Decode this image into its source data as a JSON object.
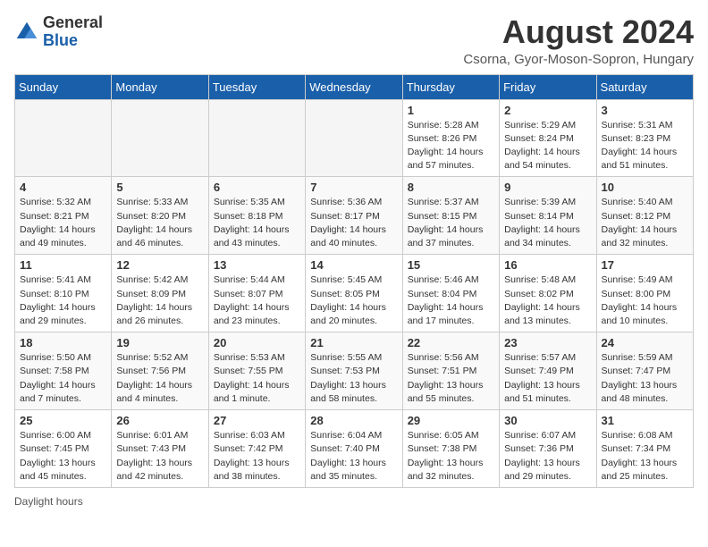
{
  "header": {
    "logo_general": "General",
    "logo_blue": "Blue",
    "month_year": "August 2024",
    "location": "Csorna, Gyor-Moson-Sopron, Hungary"
  },
  "weekdays": [
    "Sunday",
    "Monday",
    "Tuesday",
    "Wednesday",
    "Thursday",
    "Friday",
    "Saturday"
  ],
  "weeks": [
    [
      {
        "day": "",
        "info": ""
      },
      {
        "day": "",
        "info": ""
      },
      {
        "day": "",
        "info": ""
      },
      {
        "day": "",
        "info": ""
      },
      {
        "day": "1",
        "info": "Sunrise: 5:28 AM\nSunset: 8:26 PM\nDaylight: 14 hours\nand 57 minutes."
      },
      {
        "day": "2",
        "info": "Sunrise: 5:29 AM\nSunset: 8:24 PM\nDaylight: 14 hours\nand 54 minutes."
      },
      {
        "day": "3",
        "info": "Sunrise: 5:31 AM\nSunset: 8:23 PM\nDaylight: 14 hours\nand 51 minutes."
      }
    ],
    [
      {
        "day": "4",
        "info": "Sunrise: 5:32 AM\nSunset: 8:21 PM\nDaylight: 14 hours\nand 49 minutes."
      },
      {
        "day": "5",
        "info": "Sunrise: 5:33 AM\nSunset: 8:20 PM\nDaylight: 14 hours\nand 46 minutes."
      },
      {
        "day": "6",
        "info": "Sunrise: 5:35 AM\nSunset: 8:18 PM\nDaylight: 14 hours\nand 43 minutes."
      },
      {
        "day": "7",
        "info": "Sunrise: 5:36 AM\nSunset: 8:17 PM\nDaylight: 14 hours\nand 40 minutes."
      },
      {
        "day": "8",
        "info": "Sunrise: 5:37 AM\nSunset: 8:15 PM\nDaylight: 14 hours\nand 37 minutes."
      },
      {
        "day": "9",
        "info": "Sunrise: 5:39 AM\nSunset: 8:14 PM\nDaylight: 14 hours\nand 34 minutes."
      },
      {
        "day": "10",
        "info": "Sunrise: 5:40 AM\nSunset: 8:12 PM\nDaylight: 14 hours\nand 32 minutes."
      }
    ],
    [
      {
        "day": "11",
        "info": "Sunrise: 5:41 AM\nSunset: 8:10 PM\nDaylight: 14 hours\nand 29 minutes."
      },
      {
        "day": "12",
        "info": "Sunrise: 5:42 AM\nSunset: 8:09 PM\nDaylight: 14 hours\nand 26 minutes."
      },
      {
        "day": "13",
        "info": "Sunrise: 5:44 AM\nSunset: 8:07 PM\nDaylight: 14 hours\nand 23 minutes."
      },
      {
        "day": "14",
        "info": "Sunrise: 5:45 AM\nSunset: 8:05 PM\nDaylight: 14 hours\nand 20 minutes."
      },
      {
        "day": "15",
        "info": "Sunrise: 5:46 AM\nSunset: 8:04 PM\nDaylight: 14 hours\nand 17 minutes."
      },
      {
        "day": "16",
        "info": "Sunrise: 5:48 AM\nSunset: 8:02 PM\nDaylight: 14 hours\nand 13 minutes."
      },
      {
        "day": "17",
        "info": "Sunrise: 5:49 AM\nSunset: 8:00 PM\nDaylight: 14 hours\nand 10 minutes."
      }
    ],
    [
      {
        "day": "18",
        "info": "Sunrise: 5:50 AM\nSunset: 7:58 PM\nDaylight: 14 hours\nand 7 minutes."
      },
      {
        "day": "19",
        "info": "Sunrise: 5:52 AM\nSunset: 7:56 PM\nDaylight: 14 hours\nand 4 minutes."
      },
      {
        "day": "20",
        "info": "Sunrise: 5:53 AM\nSunset: 7:55 PM\nDaylight: 14 hours\nand 1 minute."
      },
      {
        "day": "21",
        "info": "Sunrise: 5:55 AM\nSunset: 7:53 PM\nDaylight: 13 hours\nand 58 minutes."
      },
      {
        "day": "22",
        "info": "Sunrise: 5:56 AM\nSunset: 7:51 PM\nDaylight: 13 hours\nand 55 minutes."
      },
      {
        "day": "23",
        "info": "Sunrise: 5:57 AM\nSunset: 7:49 PM\nDaylight: 13 hours\nand 51 minutes."
      },
      {
        "day": "24",
        "info": "Sunrise: 5:59 AM\nSunset: 7:47 PM\nDaylight: 13 hours\nand 48 minutes."
      }
    ],
    [
      {
        "day": "25",
        "info": "Sunrise: 6:00 AM\nSunset: 7:45 PM\nDaylight: 13 hours\nand 45 minutes."
      },
      {
        "day": "26",
        "info": "Sunrise: 6:01 AM\nSunset: 7:43 PM\nDaylight: 13 hours\nand 42 minutes."
      },
      {
        "day": "27",
        "info": "Sunrise: 6:03 AM\nSunset: 7:42 PM\nDaylight: 13 hours\nand 38 minutes."
      },
      {
        "day": "28",
        "info": "Sunrise: 6:04 AM\nSunset: 7:40 PM\nDaylight: 13 hours\nand 35 minutes."
      },
      {
        "day": "29",
        "info": "Sunrise: 6:05 AM\nSunset: 7:38 PM\nDaylight: 13 hours\nand 32 minutes."
      },
      {
        "day": "30",
        "info": "Sunrise: 6:07 AM\nSunset: 7:36 PM\nDaylight: 13 hours\nand 29 minutes."
      },
      {
        "day": "31",
        "info": "Sunrise: 6:08 AM\nSunset: 7:34 PM\nDaylight: 13 hours\nand 25 minutes."
      }
    ]
  ],
  "footer": {
    "note": "Daylight hours"
  }
}
